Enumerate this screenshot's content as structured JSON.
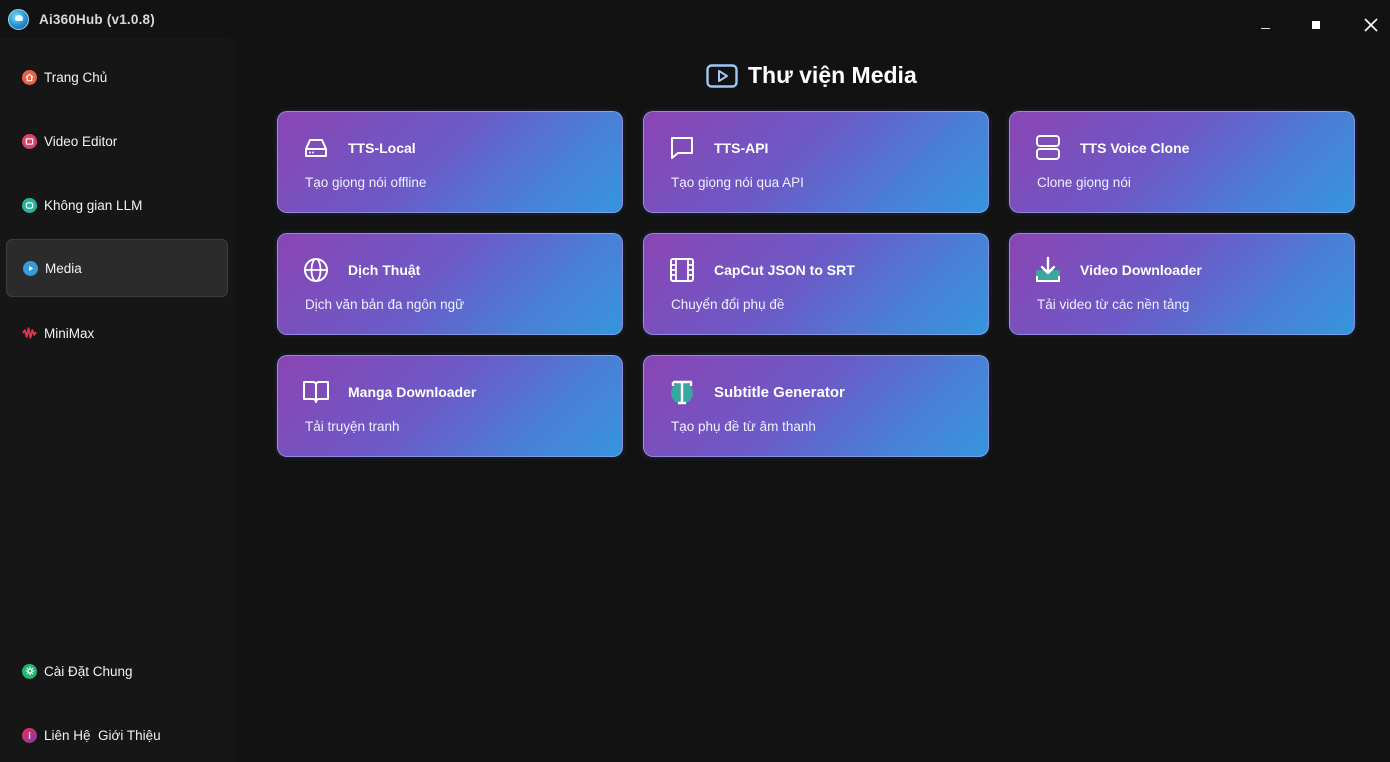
{
  "app": {
    "title": "Ai360Hub (v1.0.8)"
  },
  "sidebar": {
    "items": [
      {
        "label": "Trang Chủ",
        "icon": "home-icon",
        "color": "#e8624a"
      },
      {
        "label": "Video Editor",
        "icon": "video-editor-icon",
        "color": "#d9456a"
      },
      {
        "label": "Không gian LLM",
        "icon": "llm-icon",
        "color": "#2bb39a"
      },
      {
        "label": "Media",
        "icon": "play-icon",
        "color": "#3a9ad9",
        "active": true
      },
      {
        "label": "MiniMax",
        "icon": "waveform-icon",
        "color": "#e8324a"
      },
      {
        "label": "Cài Đặt Chung",
        "icon": "gear-icon",
        "color": "#22b573"
      },
      {
        "label": "Liên Hệ  Giới Thiệu",
        "icon": "info-icon",
        "color": "#b8367a"
      }
    ]
  },
  "main": {
    "title": "Thư viện Media",
    "cards": [
      {
        "title": "TTS-Local",
        "subtitle": "Tạo giọng nói offline",
        "icon": "hard-drive-icon"
      },
      {
        "title": "TTS-API",
        "subtitle": "Tạo giọng nói qua API",
        "icon": "chat-bubble-icon"
      },
      {
        "title": "TTS Voice Clone",
        "subtitle": "Clone giọng nói",
        "icon": "server-icon"
      },
      {
        "title": "Dịch Thuật",
        "subtitle": "Dịch văn bản đa ngôn ngữ",
        "icon": "globe-icon"
      },
      {
        "title": "CapCut JSON to SRT",
        "subtitle": "Chuyển đổi phụ đề",
        "icon": "film-icon"
      },
      {
        "title": "Video Downloader",
        "subtitle": "Tải video từ các nền tảng",
        "icon": "download-icon"
      },
      {
        "title": "Manga Downloader",
        "subtitle": "Tải truyện tranh",
        "icon": "book-icon"
      },
      {
        "title": "Subtitle Generator",
        "subtitle": "Tạo phụ đề từ âm thanh",
        "icon": "text-icon"
      }
    ]
  }
}
